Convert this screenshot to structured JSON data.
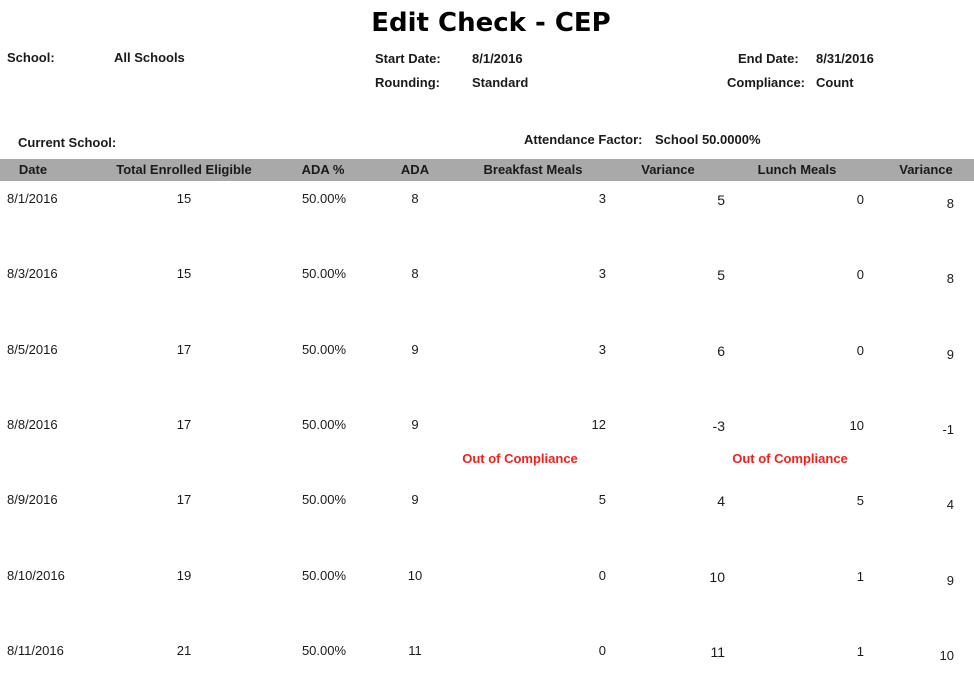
{
  "report": {
    "title": "Edit Check - CEP",
    "school_label": "School:",
    "school_value": "All Schools",
    "start_date_label": "Start Date:",
    "start_date_value": "8/1/2016",
    "end_date_label": "End Date:",
    "end_date_value": "8/31/2016",
    "rounding_label": "Rounding:",
    "rounding_value": "Standard",
    "compliance_label": "Compliance:",
    "compliance_value": "Count",
    "current_school_label": "Current School:",
    "attendance_factor_label": "Attendance Factor:",
    "attendance_factor_value": "School 50.0000%"
  },
  "table": {
    "columns": [
      "Date",
      "Total Enrolled Eligible",
      "ADA %",
      "ADA",
      "Breakfast Meals",
      "Variance",
      "Lunch Meals",
      "Variance"
    ],
    "rows": [
      {
        "date": "8/1/2016",
        "enrolled": "15",
        "ada_pct": "50.00%",
        "ada": "8",
        "breakfast": "3",
        "b_variance": "5",
        "lunch": "0",
        "l_variance": "8",
        "breakfast_status": "",
        "lunch_status": ""
      },
      {
        "date": "8/3/2016",
        "enrolled": "15",
        "ada_pct": "50.00%",
        "ada": "8",
        "breakfast": "3",
        "b_variance": "5",
        "lunch": "0",
        "l_variance": "8",
        "breakfast_status": "",
        "lunch_status": ""
      },
      {
        "date": "8/5/2016",
        "enrolled": "17",
        "ada_pct": "50.00%",
        "ada": "9",
        "breakfast": "3",
        "b_variance": "6",
        "lunch": "0",
        "l_variance": "9",
        "breakfast_status": "",
        "lunch_status": ""
      },
      {
        "date": "8/8/2016",
        "enrolled": "17",
        "ada_pct": "50.00%",
        "ada": "9",
        "breakfast": "12",
        "b_variance": "-3",
        "lunch": "10",
        "l_variance": "-1",
        "breakfast_status": "Out of Compliance",
        "lunch_status": "Out of Compliance"
      },
      {
        "date": "8/9/2016",
        "enrolled": "17",
        "ada_pct": "50.00%",
        "ada": "9",
        "breakfast": "5",
        "b_variance": "4",
        "lunch": "5",
        "l_variance": "4",
        "breakfast_status": "",
        "lunch_status": ""
      },
      {
        "date": "8/10/2016",
        "enrolled": "19",
        "ada_pct": "50.00%",
        "ada": "10",
        "breakfast": "0",
        "b_variance": "10",
        "lunch": "1",
        "l_variance": "9",
        "breakfast_status": "",
        "lunch_status": ""
      },
      {
        "date": "8/11/2016",
        "enrolled": "21",
        "ada_pct": "50.00%",
        "ada": "11",
        "breakfast": "0",
        "b_variance": "11",
        "lunch": "1",
        "l_variance": "10",
        "breakfast_status": "",
        "lunch_status": ""
      }
    ]
  },
  "colors": {
    "header_bar": "#a9a9a9",
    "out_of_compliance": "#ff1a1a"
  }
}
